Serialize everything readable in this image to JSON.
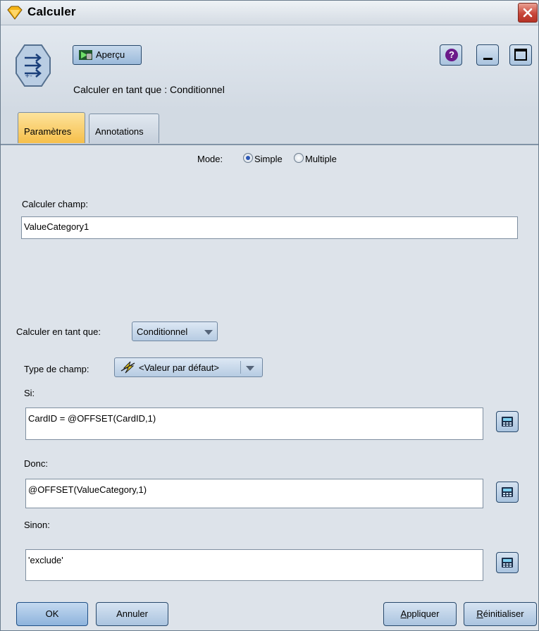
{
  "window": {
    "title": "Calculer"
  },
  "toolbar": {
    "preview_label": "Aperçu",
    "subtitle": "Calculer en tant que : Conditionnel"
  },
  "tabs": [
    {
      "label": "Paramètres",
      "active": true
    },
    {
      "label": "Annotations",
      "active": false
    }
  ],
  "mode": {
    "label": "Mode:",
    "options": [
      "Simple",
      "Multiple"
    ],
    "selected": "Simple"
  },
  "derive_field": {
    "label": "Calculer champ:",
    "value": "ValueCategory1"
  },
  "derive_as": {
    "label": "Calculer en tant que:",
    "value": "Conditionnel"
  },
  "field_type": {
    "label": "Type de champ:",
    "value": "<Valeur par défaut>"
  },
  "conditions": {
    "if_label": "Si:",
    "if_value": "CardID = @OFFSET(CardID,1)",
    "then_label": "Donc:",
    "then_value": "@OFFSET(ValueCategory,1)",
    "else_label": "Sinon:",
    "else_value": "'exclude'"
  },
  "buttons": {
    "ok": "OK",
    "cancel": "Annuler",
    "apply_first": "A",
    "apply_rest": "ppliquer",
    "reset_first": "R",
    "reset_rest": "éinitialiser"
  },
  "colors": {
    "active_tab": "#f6bf4a",
    "close_button": "#c8473a",
    "help_icon": "#6b1a8a",
    "window_bg": "#dde3ea"
  }
}
